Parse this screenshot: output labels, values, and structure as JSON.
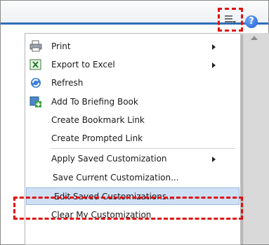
{
  "toolbar": {
    "menu_icon": "page-options-icon",
    "help_icon": "help-icon",
    "help_glyph": "?"
  },
  "menu": {
    "items": [
      {
        "label": "Print",
        "icon": "printer-icon",
        "submenu": true
      },
      {
        "label": "Export to Excel",
        "icon": "excel-icon",
        "submenu": true
      },
      {
        "label": "Refresh",
        "icon": "refresh-icon",
        "submenu": false
      },
      {
        "label": "Add To Briefing Book",
        "icon": "briefing-book-add-icon",
        "submenu": false
      },
      {
        "label": "Create Bookmark Link",
        "submenu": false
      },
      {
        "label": "Create Prompted Link",
        "submenu": false
      },
      {
        "label": "Apply Saved Customization",
        "submenu": true
      },
      {
        "label": "Save Current Customization...",
        "submenu": false
      },
      {
        "label": "Edit Saved Customizations...",
        "submenu": false,
        "highlighted": true
      },
      {
        "label": "Clear My Customization",
        "submenu": false
      }
    ]
  },
  "colors": {
    "highlight_callout": "#e01010",
    "hover_background": "#cfe0f5",
    "header_accent": "#2f6fb8"
  }
}
